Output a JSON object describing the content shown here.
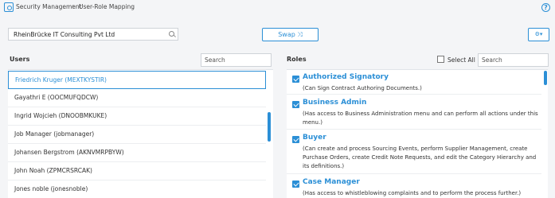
{
  "breadcrumb": {
    "root": "Security Management",
    "current": "User-Role Mapping"
  },
  "organization": {
    "value": "RheinBrücke IT Consulting Pvt Ltd"
  },
  "swap": {
    "label": "Swap ⤨"
  },
  "settings": {
    "label": "⚙▾"
  },
  "users": {
    "label": "Users",
    "search_placeholder": "Search",
    "items": [
      "Friedrich Kruger (MEXTKYSTIR)",
      "Gayathri E (OOCMUFQDCW)",
      "Ingrid Wojcieh (DNOOBMKUKE)",
      "Job Manager (jobmanager)",
      "Johansen Bergstrom (AKNVMRPBYW)",
      "John Noah (ZPMCRSRCAK)",
      "Jones noble (jonesnoble)"
    ]
  },
  "roles": {
    "label": "Roles",
    "select_all": "Select All",
    "search_placeholder": "Search",
    "items": [
      {
        "name": "Authorized Signatory",
        "desc": "(Can Sign Contract Authoring Documents.)"
      },
      {
        "name": "Business Admin",
        "desc": "(Has access to Business Administration menu and can perform all actions under this menu.)"
      },
      {
        "name": "Buyer",
        "desc": "(Can create and process Sourcing Events, perform Supplier Management, create Purchase Orders, create Credit Note Requests, and edit the Category Hierarchy and its definitions.)"
      },
      {
        "name": "Case Manager",
        "desc": "(Has access to whistleblowing complaints and to perform the process further.)"
      }
    ]
  },
  "colors": {
    "accent": "#2b8fd6"
  }
}
